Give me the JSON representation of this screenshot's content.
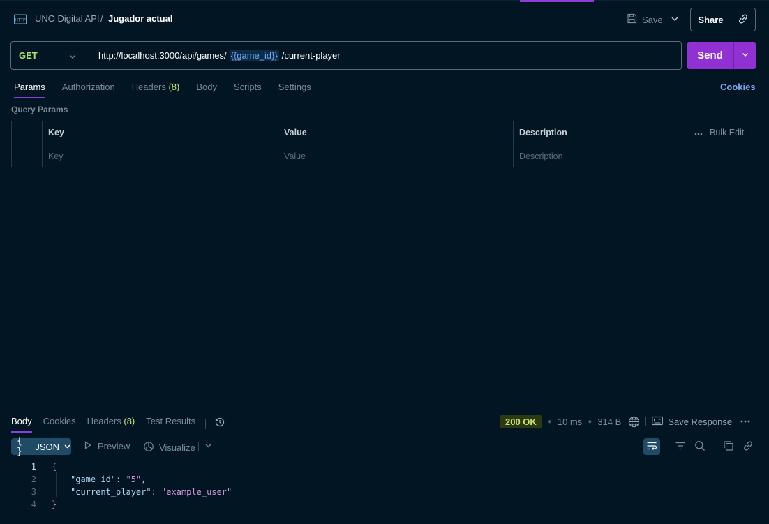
{
  "header": {
    "collection": "UNO Digital API",
    "separator": "/",
    "request_name": "Jugador actual",
    "save_label": "Save",
    "share_label": "Share"
  },
  "request": {
    "method": "GET",
    "url_prefix": "http://localhost:3000/api/games/",
    "url_variable": "{{game_id}}",
    "url_suffix": "/current-player",
    "send_label": "Send"
  },
  "request_tabs": [
    {
      "label": "Params",
      "active": true
    },
    {
      "label": "Authorization"
    },
    {
      "label": "Headers",
      "count": "(8)"
    },
    {
      "label": "Body"
    },
    {
      "label": "Scripts"
    },
    {
      "label": "Settings"
    }
  ],
  "cookies_link": "Cookies",
  "query_params": {
    "section_label": "Query Params",
    "columns": [
      "Key",
      "Value",
      "Description"
    ],
    "bulk_edit": "Bulk Edit",
    "placeholders": [
      "Key",
      "Value",
      "Description"
    ]
  },
  "response": {
    "tabs": [
      {
        "label": "Body",
        "active": true
      },
      {
        "label": "Cookies"
      },
      {
        "label": "Headers",
        "count": "(8)"
      },
      {
        "label": "Test Results"
      }
    ],
    "status": "200 OK",
    "time": "10 ms",
    "size": "314 B",
    "save_response": "Save Response",
    "format": "JSON",
    "format_brace": "{ }",
    "preview": "Preview",
    "visualize": "Visualize",
    "code_lines": [
      {
        "num": "1",
        "text": "{"
      },
      {
        "num": "2",
        "key": "\"game_id\"",
        "value": "\"5\"",
        "trail": ","
      },
      {
        "num": "3",
        "key": "\"current_player\"",
        "value": "\"example_user\"",
        "trail": ""
      },
      {
        "num": "4",
        "text": "}"
      }
    ]
  },
  "colors": {
    "background": "#021522",
    "accent": "#9131d4",
    "method": "#a7e36a",
    "status_ok": "#c8e27a",
    "link": "#7fa5f0"
  }
}
